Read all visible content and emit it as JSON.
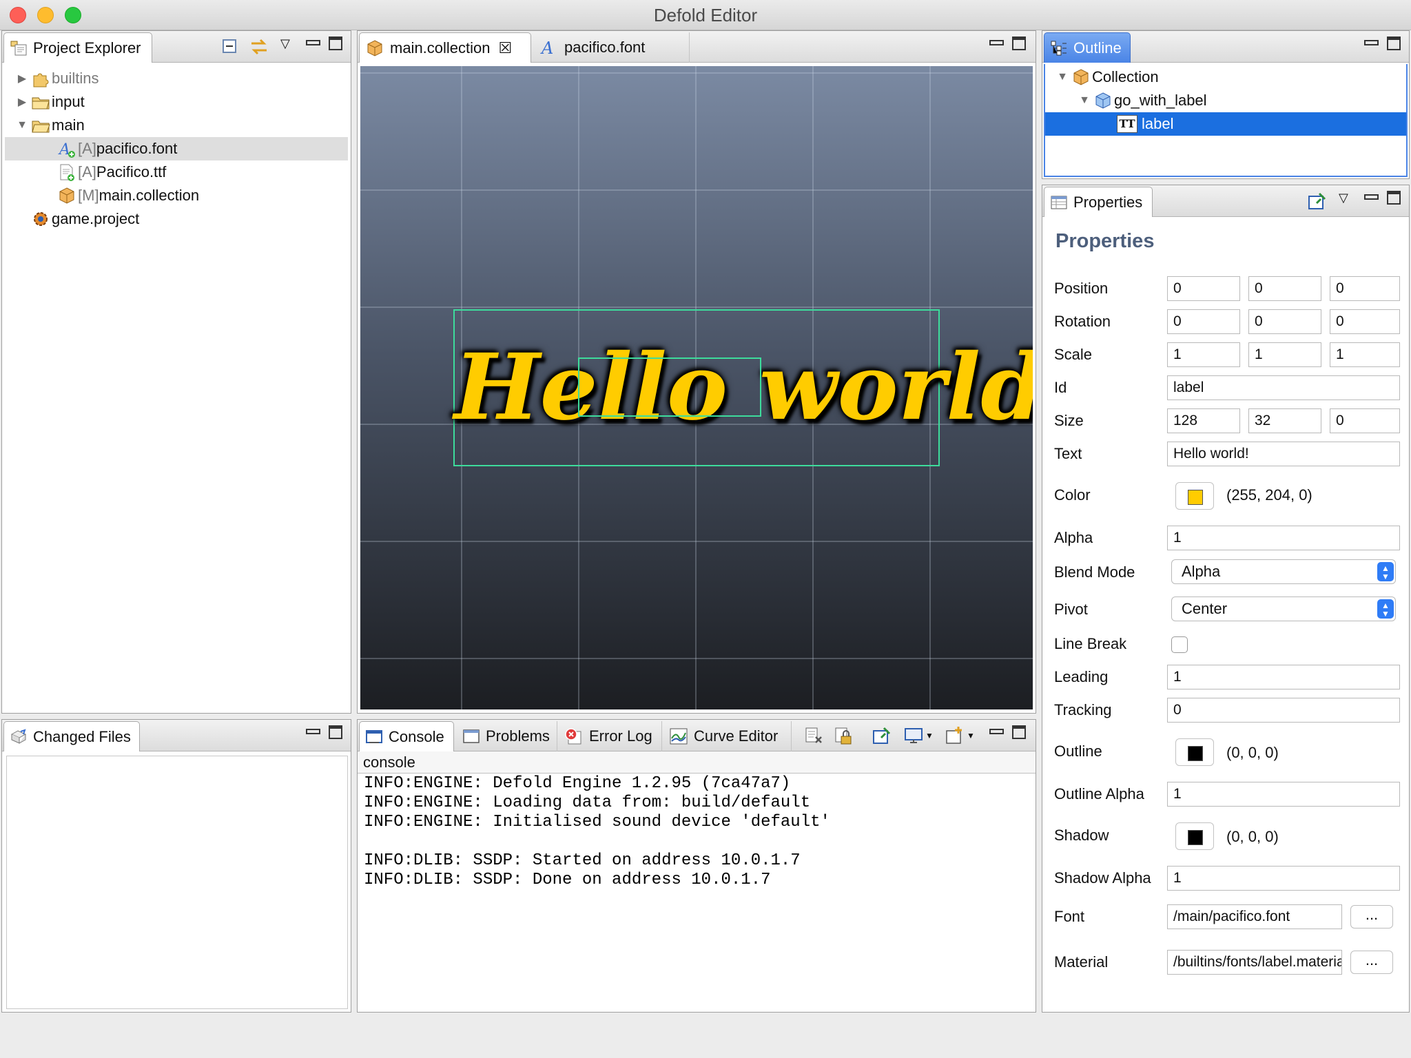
{
  "window": {
    "title": "Defold Editor"
  },
  "project_explorer": {
    "tab_label": "Project Explorer",
    "items": [
      {
        "label": "builtins",
        "grey": true
      },
      {
        "label": "input"
      },
      {
        "label": "main"
      },
      {
        "prefix": "[A]",
        "label": "pacifico.font"
      },
      {
        "prefix": "[A]",
        "label": "Pacifico.ttf"
      },
      {
        "prefix": "[M]",
        "label": "main.collection"
      },
      {
        "label": "game.project"
      }
    ]
  },
  "changed_files": {
    "tab_label": "Changed Files"
  },
  "editor": {
    "tabs": [
      {
        "label": "main.collection",
        "close": "☒"
      },
      {
        "label": "pacifico.font"
      }
    ],
    "scene_text": "Hello world!"
  },
  "bottom": {
    "tabs": [
      "Console",
      "Problems",
      "Error Log",
      "Curve Editor"
    ],
    "console_title": "console",
    "console_lines": [
      "INFO:ENGINE: Defold Engine 1.2.95 (7ca47a7)",
      "INFO:ENGINE: Loading data from: build/default",
      "INFO:ENGINE: Initialised sound device 'default'",
      "",
      "INFO:DLIB: SSDP: Started on address 10.0.1.7",
      "INFO:DLIB: SSDP: Done on address 10.0.1.7"
    ]
  },
  "outline": {
    "tab_label": "Outline",
    "items": [
      {
        "label": "Collection"
      },
      {
        "label": "go_with_label"
      },
      {
        "label": "label",
        "icon_text": "TT"
      }
    ]
  },
  "properties": {
    "tab_label": "Properties",
    "heading": "Properties",
    "position": {
      "label": "Position",
      "x": "0",
      "y": "0",
      "z": "0"
    },
    "rotation": {
      "label": "Rotation",
      "x": "0",
      "y": "0",
      "z": "0"
    },
    "scale": {
      "label": "Scale",
      "x": "1",
      "y": "1",
      "z": "1"
    },
    "id": {
      "label": "Id",
      "value": "label"
    },
    "size": {
      "label": "Size",
      "x": "128",
      "y": "32",
      "z": "0"
    },
    "text": {
      "label": "Text",
      "value": "Hello world!"
    },
    "color": {
      "label": "Color",
      "value": "(255, 204, 0)",
      "swatch": "#ffcc00"
    },
    "alpha": {
      "label": "Alpha",
      "value": "1"
    },
    "blend_mode": {
      "label": "Blend Mode",
      "value": "Alpha"
    },
    "pivot": {
      "label": "Pivot",
      "value": "Center"
    },
    "line_break": {
      "label": "Line Break",
      "checked": false
    },
    "leading": {
      "label": "Leading",
      "value": "1"
    },
    "tracking": {
      "label": "Tracking",
      "value": "0"
    },
    "outline": {
      "label": "Outline",
      "value": "(0, 0, 0)",
      "swatch": "#000000"
    },
    "outline_alpha": {
      "label": "Outline Alpha",
      "value": "1"
    },
    "shadow": {
      "label": "Shadow",
      "value": "(0, 0, 0)",
      "swatch": "#000000"
    },
    "shadow_alpha": {
      "label": "Shadow Alpha",
      "value": "1"
    },
    "font": {
      "label": "Font",
      "value": "/main/pacifico.font",
      "browse": "..."
    },
    "material": {
      "label": "Material",
      "value": "/builtins/fonts/label.material",
      "browse": "..."
    }
  }
}
